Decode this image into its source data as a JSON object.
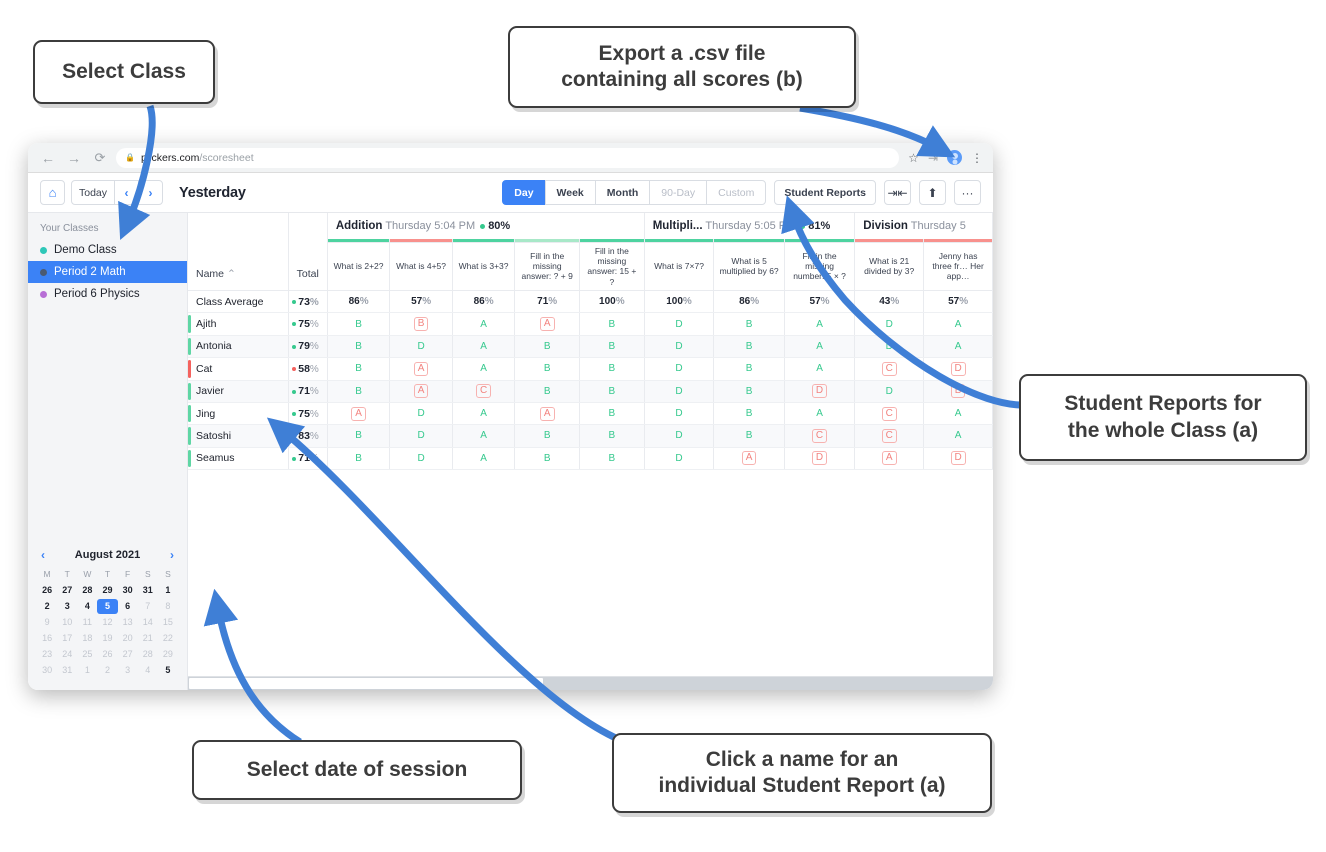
{
  "browser": {
    "back_icon": "back-arrow-icon",
    "forward_icon": "forward-arrow-icon",
    "reload_icon": "reload-icon",
    "lock_icon": "lock-icon",
    "url_domain": "plickers.com",
    "url_path": "/scoresheet",
    "star_icon": "star-icon",
    "extension_icon": "extension-icon",
    "profile_icon": "profile-avatar-icon",
    "menu_icon": "three-dot-menu-icon"
  },
  "toolbar": {
    "home_icon": "home-icon",
    "today_label": "Today",
    "prev_icon": "chevron-left-icon",
    "next_icon": "chevron-right-icon",
    "page_title": "Yesterday",
    "ranges": [
      {
        "label": "Day",
        "state": "active"
      },
      {
        "label": "Week",
        "state": "normal"
      },
      {
        "label": "Month",
        "state": "normal"
      },
      {
        "label": "90-Day",
        "state": "disabled"
      },
      {
        "label": "Custom",
        "state": "disabled"
      }
    ],
    "student_reports_label": "Student Reports",
    "collapse_icon": "collapse-columns-icon",
    "export_icon": "export-share-icon",
    "more_icon": "more-options-icon"
  },
  "sidebar": {
    "heading": "Your Classes",
    "classes": [
      {
        "label": "Demo Class",
        "color": "#2ec7b8",
        "selected": false
      },
      {
        "label": "Period 2 Math",
        "color": "#4a5a72",
        "selected": true
      },
      {
        "label": "Period 6 Physics",
        "color": "#b86fd6",
        "selected": false
      }
    ]
  },
  "calendar": {
    "prev_icon": "calendar-prev-icon",
    "next_icon": "calendar-next-icon",
    "title": "August 2021",
    "dow": [
      "M",
      "T",
      "W",
      "T",
      "F",
      "S",
      "S"
    ],
    "weeks": [
      [
        {
          "d": "26",
          "s": "bold"
        },
        {
          "d": "27",
          "s": "bold"
        },
        {
          "d": "28",
          "s": "bold"
        },
        {
          "d": "29",
          "s": "bold"
        },
        {
          "d": "30",
          "s": "bold"
        },
        {
          "d": "31",
          "s": "bold"
        },
        {
          "d": "1",
          "s": "bold"
        }
      ],
      [
        {
          "d": "2",
          "s": "bold"
        },
        {
          "d": "3",
          "s": "bold"
        },
        {
          "d": "4",
          "s": "bold"
        },
        {
          "d": "5",
          "s": "sel"
        },
        {
          "d": "6",
          "s": "bold"
        },
        {
          "d": "7",
          "s": "mut"
        },
        {
          "d": "8",
          "s": "mut"
        }
      ],
      [
        {
          "d": "9",
          "s": "mut"
        },
        {
          "d": "10",
          "s": "mut"
        },
        {
          "d": "11",
          "s": "mut"
        },
        {
          "d": "12",
          "s": "mut"
        },
        {
          "d": "13",
          "s": "mut"
        },
        {
          "d": "14",
          "s": "mut"
        },
        {
          "d": "15",
          "s": "mut"
        }
      ],
      [
        {
          "d": "16",
          "s": "mut"
        },
        {
          "d": "17",
          "s": "mut"
        },
        {
          "d": "18",
          "s": "mut"
        },
        {
          "d": "19",
          "s": "mut"
        },
        {
          "d": "20",
          "s": "mut"
        },
        {
          "d": "21",
          "s": "mut"
        },
        {
          "d": "22",
          "s": "mut"
        }
      ],
      [
        {
          "d": "23",
          "s": "mut"
        },
        {
          "d": "24",
          "s": "mut"
        },
        {
          "d": "25",
          "s": "mut"
        },
        {
          "d": "26",
          "s": "mut"
        },
        {
          "d": "27",
          "s": "mut"
        },
        {
          "d": "28",
          "s": "mut"
        },
        {
          "d": "29",
          "s": "mut"
        }
      ],
      [
        {
          "d": "30",
          "s": "mut"
        },
        {
          "d": "31",
          "s": "mut"
        },
        {
          "d": "1",
          "s": "mut"
        },
        {
          "d": "2",
          "s": "mut"
        },
        {
          "d": "3",
          "s": "mut"
        },
        {
          "d": "4",
          "s": "mut"
        },
        {
          "d": "5",
          "s": "bold"
        }
      ]
    ]
  },
  "sheet": {
    "name_header": "Name",
    "sort_icon": "sort-ascending-icon",
    "total_header": "Total",
    "sets": [
      {
        "name": "Addition",
        "time": "Thursday 5:04 PM",
        "score": "80%",
        "span": 5
      },
      {
        "name": "Multipli...",
        "time": "Thursday 5:05 PM",
        "score": "81%",
        "span": 3
      },
      {
        "name": "Division",
        "time": "Thursday 5",
        "score": "",
        "span": 2
      }
    ],
    "questions": [
      {
        "text": "What is 2+2?",
        "bar": "#4ed3a0",
        "average": "86%"
      },
      {
        "text": "What is 4+5?",
        "bar": "#f8918d",
        "average": "57%"
      },
      {
        "text": "What is 3+3?",
        "bar": "#4ed3a0",
        "average": "86%"
      },
      {
        "text": "Fill in the missing answer: ? + 9",
        "bar": "#a8e8c8",
        "average": "71%"
      },
      {
        "text": "Fill in the missing answer: 15 + ?",
        "bar": "#4ed3a0",
        "average": "100%"
      },
      {
        "text": "What is 7×7?",
        "bar": "#4ed3a0",
        "average": "100%"
      },
      {
        "text": "What is 5 multiplied by 6?",
        "bar": "#4ed3a0",
        "average": "86%"
      },
      {
        "text": "Fill in the missing number: 5 × ?",
        "bar": "#4ed3a0",
        "average": "57%"
      },
      {
        "text": "What is 21 divided by 3?",
        "bar": "#f8918d",
        "average": "43%"
      },
      {
        "text": "Jenny has three fr… Her app…",
        "bar": "#f8918d",
        "average": "57%"
      }
    ],
    "class_average": {
      "label": "Class Average",
      "total": "73%",
      "dot": "#36c98e"
    },
    "students": [
      {
        "name": "Ajith",
        "total": "75%",
        "dot": "#36c98e",
        "bar": "#5fd6a4",
        "answers": [
          {
            "v": "B",
            "c": "r"
          },
          {
            "v": "B",
            "c": "w"
          },
          {
            "v": "A",
            "c": "r"
          },
          {
            "v": "A",
            "c": "w"
          },
          {
            "v": "B",
            "c": "r"
          },
          {
            "v": "D",
            "c": "r"
          },
          {
            "v": "B",
            "c": "r"
          },
          {
            "v": "A",
            "c": "r"
          },
          {
            "v": "D",
            "c": "r"
          },
          {
            "v": "A",
            "c": "r"
          }
        ]
      },
      {
        "name": "Antonia",
        "total": "79%",
        "dot": "#36c98e",
        "bar": "#5fd6a4",
        "answers": [
          {
            "v": "B",
            "c": "r"
          },
          {
            "v": "D",
            "c": "r"
          },
          {
            "v": "A",
            "c": "r"
          },
          {
            "v": "B",
            "c": "r"
          },
          {
            "v": "B",
            "c": "r"
          },
          {
            "v": "D",
            "c": "r"
          },
          {
            "v": "B",
            "c": "r"
          },
          {
            "v": "A",
            "c": "r"
          },
          {
            "v": "D",
            "c": "r"
          },
          {
            "v": "A",
            "c": "r"
          }
        ]
      },
      {
        "name": "Cat",
        "total": "58%",
        "dot": "#f4625e",
        "bar": "#f4625e",
        "answers": [
          {
            "v": "B",
            "c": "r"
          },
          {
            "v": "A",
            "c": "w"
          },
          {
            "v": "A",
            "c": "r"
          },
          {
            "v": "B",
            "c": "r"
          },
          {
            "v": "B",
            "c": "r"
          },
          {
            "v": "D",
            "c": "r"
          },
          {
            "v": "B",
            "c": "r"
          },
          {
            "v": "A",
            "c": "r"
          },
          {
            "v": "C",
            "c": "w"
          },
          {
            "v": "D",
            "c": "w"
          }
        ]
      },
      {
        "name": "Javier",
        "total": "71%",
        "dot": "#36c98e",
        "bar": "#5fd6a4",
        "answers": [
          {
            "v": "B",
            "c": "r"
          },
          {
            "v": "A",
            "c": "w"
          },
          {
            "v": "C",
            "c": "w"
          },
          {
            "v": "B",
            "c": "r"
          },
          {
            "v": "B",
            "c": "r"
          },
          {
            "v": "D",
            "c": "r"
          },
          {
            "v": "B",
            "c": "r"
          },
          {
            "v": "D",
            "c": "w"
          },
          {
            "v": "D",
            "c": "r"
          },
          {
            "v": "B",
            "c": "w"
          }
        ]
      },
      {
        "name": "Jing",
        "total": "75%",
        "dot": "#36c98e",
        "bar": "#5fd6a4",
        "answers": [
          {
            "v": "A",
            "c": "w"
          },
          {
            "v": "D",
            "c": "r"
          },
          {
            "v": "A",
            "c": "r"
          },
          {
            "v": "A",
            "c": "w"
          },
          {
            "v": "B",
            "c": "r"
          },
          {
            "v": "D",
            "c": "r"
          },
          {
            "v": "B",
            "c": "r"
          },
          {
            "v": "A",
            "c": "r"
          },
          {
            "v": "C",
            "c": "w"
          },
          {
            "v": "A",
            "c": "r"
          }
        ]
      },
      {
        "name": "Satoshi",
        "total": "83%",
        "dot": "#36c98e",
        "bar": "#5fd6a4",
        "answers": [
          {
            "v": "B",
            "c": "r"
          },
          {
            "v": "D",
            "c": "r"
          },
          {
            "v": "A",
            "c": "r"
          },
          {
            "v": "B",
            "c": "r"
          },
          {
            "v": "B",
            "c": "r"
          },
          {
            "v": "D",
            "c": "r"
          },
          {
            "v": "B",
            "c": "r"
          },
          {
            "v": "C",
            "c": "w"
          },
          {
            "v": "C",
            "c": "w"
          },
          {
            "v": "A",
            "c": "r"
          }
        ]
      },
      {
        "name": "Seamus",
        "total": "71%",
        "dot": "#36c98e",
        "bar": "#5fd6a4",
        "answers": [
          {
            "v": "B",
            "c": "r"
          },
          {
            "v": "D",
            "c": "r"
          },
          {
            "v": "A",
            "c": "r"
          },
          {
            "v": "B",
            "c": "r"
          },
          {
            "v": "B",
            "c": "r"
          },
          {
            "v": "D",
            "c": "r"
          },
          {
            "v": "A",
            "c": "w"
          },
          {
            "v": "D",
            "c": "w"
          },
          {
            "v": "A",
            "c": "w"
          },
          {
            "v": "D",
            "c": "w"
          }
        ]
      }
    ]
  },
  "callouts": {
    "select_class": "Select Class",
    "export_csv": "Export a .csv file\ncontaining all scores (b)",
    "student_reports": "Student Reports for\nthe whole Class (a)",
    "select_date": "Select date of session",
    "click_name": "Click a name for an\nindividual Student Report (a)"
  },
  "colors": {
    "accent_blue": "#3b82f6",
    "arrow_blue": "#3f7fd6",
    "correct_green": "#36c98e",
    "wrong_red": "#f2837f"
  }
}
